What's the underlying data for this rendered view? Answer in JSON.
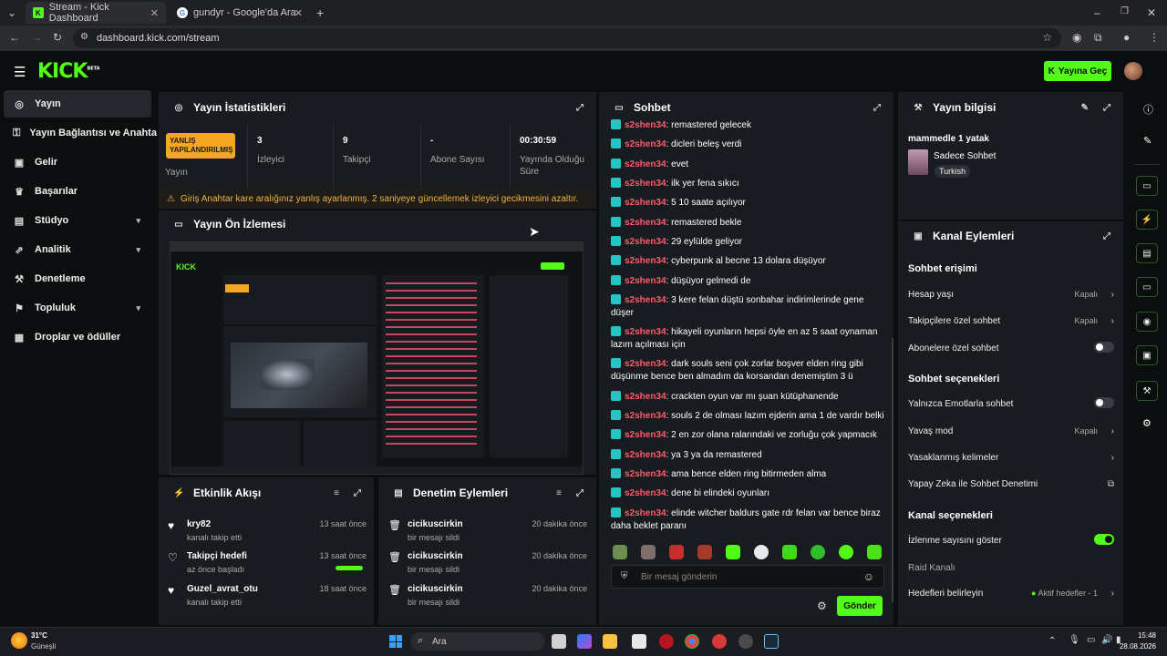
{
  "browser": {
    "tabs": [
      {
        "title": "Stream - Kick Dashboard"
      },
      {
        "title": "gundyr - Google'da Ara"
      }
    ],
    "url": "dashboard.kick.com/stream"
  },
  "header": {
    "logo": "KICK",
    "logo_tag": "BETA",
    "go_live": "Yayına Geç"
  },
  "sidebar": {
    "items": [
      {
        "label": "Yayın",
        "icon": "stream-icon"
      },
      {
        "label": "Yayın Bağlantısı ve Anahtarı",
        "icon": "key-icon"
      },
      {
        "label": "Gelir",
        "icon": "revenue-icon"
      },
      {
        "label": "Başarılar",
        "icon": "trophy-icon"
      },
      {
        "label": "Stüdyo",
        "icon": "studio-icon"
      },
      {
        "label": "Analitik",
        "icon": "analytics-icon"
      },
      {
        "label": "Denetleme",
        "icon": "moderation-icon"
      },
      {
        "label": "Topluluk",
        "icon": "community-icon"
      },
      {
        "label": "Droplar ve ödüller",
        "icon": "gift-icon"
      }
    ]
  },
  "stats": {
    "title": "Yayın İstatistikleri",
    "badge": "YANLIŞ YAPILANDIRILMIŞ",
    "stream_label": "Yayın",
    "viewers": {
      "value": "3",
      "label": "İzleyici"
    },
    "followers": {
      "value": "9",
      "label": "Takipçi"
    },
    "subs": {
      "value": "-",
      "label": "Abone Sayısı"
    },
    "uptime": {
      "value": "00:30:59",
      "label": "Yayında Olduğu Süre"
    },
    "warning": "Giriş Anahtar kare aralığınız yanlış ayarlanmış. 2 saniyeye güncellemek izleyici gecikmesini azaltır."
  },
  "preview": {
    "title": "Yayın Ön İzlemesi"
  },
  "activity": {
    "title": "Etkinlik Akışı",
    "items": [
      {
        "name": "kry82",
        "sub": "kanalı takip etti",
        "time": "13 saat önce"
      },
      {
        "name": "Takipçi hedefi",
        "sub": "az önce başladı",
        "time": "13 saat önce"
      },
      {
        "name": "Guzel_avrat_otu",
        "sub": "kanalı takip etti",
        "time": "18 saat önce"
      }
    ]
  },
  "modlog": {
    "title": "Denetim Eylemleri",
    "items": [
      {
        "name": "cicikuscirkin",
        "sub": "bir mesajı sildi",
        "time": "20 dakika önce"
      },
      {
        "name": "cicikuscirkin",
        "sub": "bir mesajı sildi",
        "time": "20 dakika önce"
      },
      {
        "name": "cicikuscirkin",
        "sub": "bir mesajı sildi",
        "time": "20 dakika önce"
      }
    ]
  },
  "chat": {
    "title": "Sohbet",
    "messages": [
      {
        "user": "s2shen34",
        "text": ": remastered gelecek"
      },
      {
        "user": "s2shen34",
        "text": ": dicleri beleş verdi"
      },
      {
        "user": "s2shen34",
        "text": ": evet"
      },
      {
        "user": "s2shen34",
        "text": ": ilk yer fena sıkıcı"
      },
      {
        "user": "s2shen34",
        "text": ": 5 10 saate açılıyor"
      },
      {
        "user": "s2shen34",
        "text": ": remastered bekle"
      },
      {
        "user": "s2shen34",
        "text": ": 29 eylülde geliyor"
      },
      {
        "user": "s2shen34",
        "text": ": cyberpunk al becne 13 dolara düşüyor"
      },
      {
        "user": "s2shen34",
        "text": ": düşüyor gelmedi de"
      },
      {
        "user": "s2shen34",
        "text": ": 3 kere felan düştü sonbahar indirimlerinde gene düşer"
      },
      {
        "user": "s2shen34",
        "text": ": hikayeli oyunların hepsi öyle en az 5 saat oynaman lazım açılması için"
      },
      {
        "user": "s2shen34",
        "text": ": dark souls seni çok zorlar boşver elden ring gibi düşünme bence ben almadım da korsandan denemiştim 3 ü"
      },
      {
        "user": "s2shen34",
        "text": ": crackten oyun var mı şuan kütüphanende"
      },
      {
        "user": "s2shen34",
        "text": ": souls 2 de olması lazım ejderin ama 1 de vardır belki"
      },
      {
        "user": "s2shen34",
        "text": ": 2 en zor olana ralarındaki ve zorluğu çok yapmacık"
      },
      {
        "user": "s2shen34",
        "text": ": ya 3 ya da remastered"
      },
      {
        "user": "s2shen34",
        "text": ": ama bence elden ring bitirmeden alma"
      },
      {
        "user": "s2shen34",
        "text": ": dene bi elindeki oyunları"
      },
      {
        "user": "s2shen34",
        "text": ": elinde witcher baldurs gate rdr felan var bence biraz daha beklet paranı"
      }
    ],
    "placeholder": "Bir mesaj gönderin",
    "send": "Gönder"
  },
  "info": {
    "title": "Yayın bilgisi",
    "stream_title": "mammedle 1 yatak",
    "category": "Sadece Sohbet",
    "language": "Turkish"
  },
  "channel": {
    "title": "Kanal Eylemleri",
    "chat_access": "Sohbet erişimi",
    "account_age": {
      "label": "Hesap yaşı",
      "value": "Kapalı"
    },
    "followers_only": {
      "label": "Takipçilere özel sohbet",
      "value": "Kapalı"
    },
    "subs_only": {
      "label": "Abonelere özel sohbet"
    },
    "chat_options": "Sohbet seçenekleri",
    "emote_only": {
      "label": "Yalnızca Emotlarla sohbet"
    },
    "slow_mode": {
      "label": "Yavaş mod",
      "value": "Kapalı"
    },
    "banned_words": {
      "label": "Yasaklanmış kelimeler"
    },
    "ai_mod": {
      "label": "Yapay Zeka ile Sohbet Denetimi"
    },
    "channel_options": "Kanal seçenekleri",
    "show_viewers": {
      "label": "İzlenme sayısını göster"
    },
    "raid": {
      "label": "Raid Kanalı"
    },
    "goals": {
      "label": "Hedefleri belirleyin",
      "value": "Aktif hedefler - 1"
    }
  },
  "taskbar": {
    "temp": "31°C",
    "weather": "Güneşli",
    "search": "Ara",
    "time": "15:48",
    "date": "28.08.2026"
  },
  "colors": {
    "accent": "#53fc18",
    "panel": "#181b1f",
    "bg": "#0b0e0f",
    "username": "#ff5b6b",
    "warning": "#f5a623"
  }
}
